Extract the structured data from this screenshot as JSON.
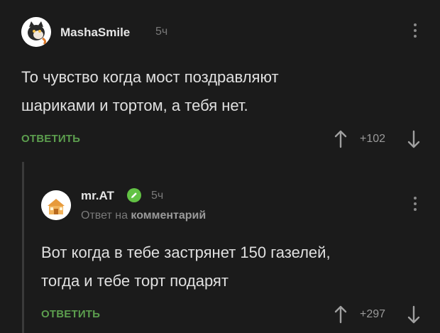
{
  "comment": {
    "username": "MashaSmile",
    "time": "5ч",
    "text_line1": "То чувство когда мост поздравляют",
    "text_line2": "шариками и тортом, а тебя нет.",
    "reply_label": "ОТВЕТИТЬ",
    "rating": "+102"
  },
  "reply": {
    "username": "mr.AT",
    "time": "5ч",
    "reply_to_prefix": "Ответ на",
    "reply_to_target": "комментарий",
    "text_line1": "Вот когда в тебе застрянет 150 газелей,",
    "text_line2": "тогда и тебе торт подарят",
    "reply_label": "ОТВЕТИТЬ",
    "rating": "+297"
  },
  "colors": {
    "background": "#1b1b1b",
    "accent_green": "#5c9e4e",
    "badge_green": "#62c244"
  },
  "icons": {
    "upvote": "arrow-up-icon",
    "downvote": "arrow-down-icon",
    "menu": "more-vertical-icon",
    "verified": "pencil-badge-icon"
  }
}
